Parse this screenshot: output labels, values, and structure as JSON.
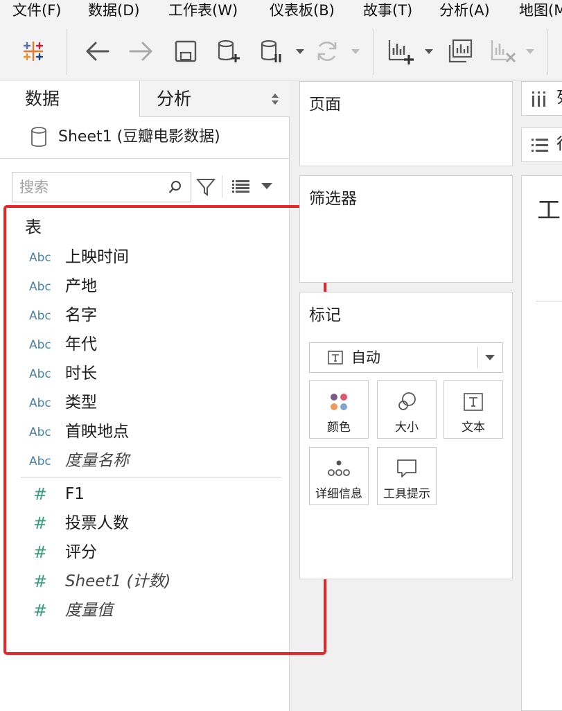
{
  "menubar": {
    "items": [
      "文件(F)",
      "数据(D)",
      "工作表(W)",
      "仪表板(B)",
      "故事(T)",
      "分析(A)",
      "地图(M)"
    ]
  },
  "toolbar": {
    "buttons": [
      "tableau-logo-icon",
      "back-icon",
      "forward-icon",
      "save-icon",
      "new-data-source-icon",
      "pause-updates-icon",
      "refresh-icon",
      "new-worksheet-icon",
      "duplicate-sheet-icon",
      "clear-sheet-icon"
    ]
  },
  "left_pane": {
    "tabs": {
      "data": "数据",
      "analysis": "分析"
    },
    "data_source": "Sheet1 (豆瓣电影数据)",
    "search_placeholder": "搜索",
    "section_label": "表",
    "dimension_type_label": "Abc",
    "dimensions": [
      "上映时间",
      "产地",
      "名字",
      "年代",
      "时长",
      "类型",
      "首映地点",
      "度量名称"
    ],
    "measure_type_label": "#",
    "measures": [
      "F1",
      "投票人数",
      "评分",
      "Sheet1 (计数)",
      "度量值"
    ]
  },
  "cards": {
    "pages": "页面",
    "filters": "筛选器",
    "marks": "标记",
    "mark_type": "自动",
    "mark_buttons": [
      "颜色",
      "大小",
      "文本",
      "详细信息",
      "工具提示"
    ]
  },
  "shelves": {
    "columns": "列",
    "rows": "行"
  },
  "worksheet": {
    "title_fragment": "工"
  },
  "colors": {
    "highlight": "#e8262a",
    "abc": "#4a7fa8",
    "measure": "#3a9e7d"
  }
}
